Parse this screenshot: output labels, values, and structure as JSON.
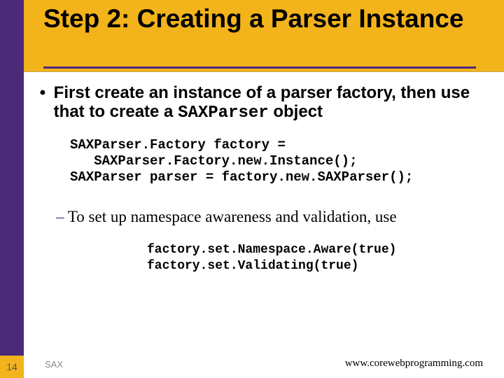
{
  "title": "Step 2: Creating a Parser Instance",
  "bullet1_prefix": "First create an instance of a parser factory, then use that to create a ",
  "bullet1_code": "SAXParser",
  "bullet1_suffix": " object",
  "code1": "SAXParser.Factory factory =\n   SAXParser.Factory.new.Instance();\nSAXParser parser = factory.new.SAXParser();",
  "bullet2": "To set up namespace awareness and validation, use",
  "code2": "factory.set.Namespace.Aware(true)\nfactory.set.Validating(true)",
  "page_number": "14",
  "footer_left": "SAX",
  "footer_right": "www.corewebprogramming.com"
}
